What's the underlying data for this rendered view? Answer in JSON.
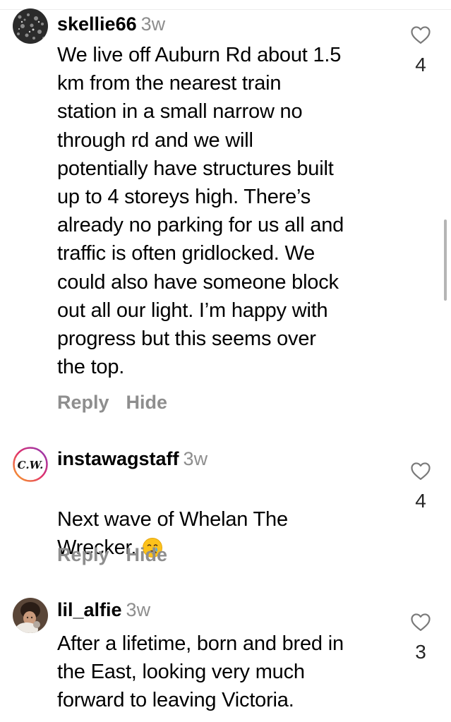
{
  "comments": [
    {
      "username": "skellie66",
      "age": "3w",
      "text": "We live off Auburn Rd about 1.5\nkm from the nearest train\nstation in a small narrow no\nthrough rd and we will\npotentially have structures built\nup to 4 storeys high. There’s\nalready no parking for us all and\ntraffic is often gridlocked. We\ncould also have someone block\nout all our light. I’m happy with\nprogress but this seems over\nthe top.",
      "likes": "4",
      "reply_label": "Reply",
      "hide_label": "Hide"
    },
    {
      "username": "instawagstaff",
      "age": "3w",
      "text": "Next wave of Whelan The\nWrecker.",
      "emoji": "crying-face-emoji",
      "avatar_text": "C.W.",
      "likes": "4",
      "reply_label": "Reply",
      "hide_label": "Hide"
    },
    {
      "username": "lil_alfie",
      "age": "3w",
      "text": "After a lifetime, born and bred in\nthe East, looking very much\nforward to leaving Victoria.",
      "likes": "3"
    }
  ],
  "colors": {
    "secondary_text": "#8e8e8e",
    "ring_gradient": [
      "#f9a826",
      "#e1306c",
      "#8a3ab9"
    ]
  }
}
